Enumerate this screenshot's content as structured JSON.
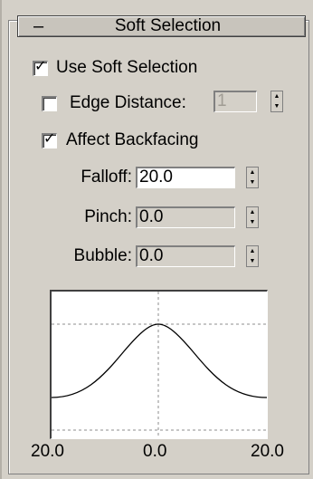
{
  "rollout": {
    "collapse_symbol": "–",
    "title": "Soft Selection"
  },
  "options": {
    "use_soft_selection": {
      "label": "Use Soft Selection",
      "checked": true
    },
    "edge_distance": {
      "label": "Edge Distance:",
      "checked": false,
      "value": "1"
    },
    "affect_backfacing": {
      "label": "Affect Backfacing",
      "checked": true
    }
  },
  "params": {
    "falloff": {
      "label": "Falloff:",
      "value": "20.0"
    },
    "pinch": {
      "label": "Pinch:",
      "value": "0.0"
    },
    "bubble": {
      "label": "Bubble:",
      "value": "0.0"
    }
  },
  "graph": {
    "left_label": "20.0",
    "center_label": "0.0",
    "right_label": "20.0"
  },
  "icons": {
    "check": "check-icon",
    "spinner_up": "up-arrow-icon",
    "spinner_down": "down-arrow-icon"
  }
}
